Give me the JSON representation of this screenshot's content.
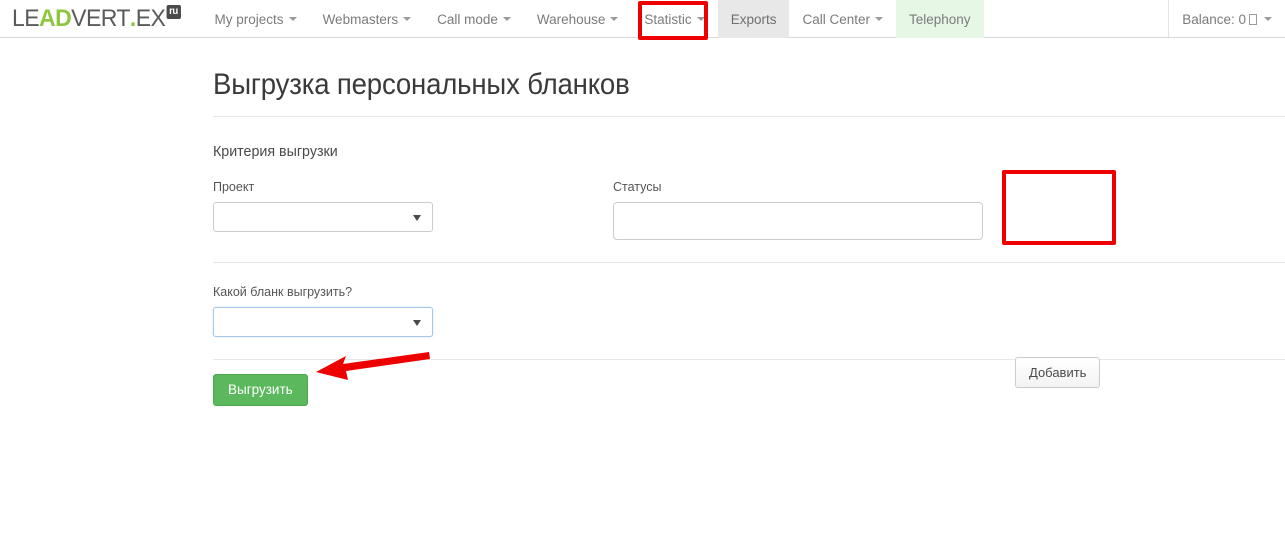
{
  "brand": {
    "part1": "LE",
    "part_ad": "AD",
    "part2": "VERT",
    "dot": ".",
    "part3": "EX",
    "badge": "ru"
  },
  "nav": {
    "items": [
      {
        "label": "My projects",
        "caret": true,
        "state": "normal"
      },
      {
        "label": "Webmasters",
        "caret": true,
        "state": "normal"
      },
      {
        "label": "Call mode",
        "caret": true,
        "state": "normal"
      },
      {
        "label": "Warehouse",
        "caret": true,
        "state": "normal"
      },
      {
        "label": "Statistic",
        "caret": true,
        "state": "normal"
      },
      {
        "label": "Exports",
        "caret": false,
        "state": "active"
      },
      {
        "label": "Call Center",
        "caret": true,
        "state": "normal"
      },
      {
        "label": "Telephony",
        "caret": false,
        "state": "greenbg"
      }
    ],
    "balance_label": "Balance: 0"
  },
  "page": {
    "title": "Выгрузка персональных бланков",
    "section_title": "Критерия выгрузки"
  },
  "form": {
    "project_label": "Проект",
    "project_value": "",
    "project_placeholder": "",
    "statuses_label": "Статусы",
    "statuses_value": "",
    "statuses_placeholder": "",
    "add_button": "Добавить",
    "blank_label": "Какой бланк выгрузить?",
    "blank_value": "",
    "submit_button": "Выгрузить"
  },
  "annotations": {
    "exports_highlight": "red-box-around-exports-tab",
    "add_highlight": "red-box-around-add-button",
    "arrow": "red-arrow-pointing-at-submit-button",
    "color": "#ee0000"
  },
  "colors": {
    "brand_green": "#8dc63f",
    "submit_green": "#5cb85c",
    "annotation_red": "#ee0000",
    "telephony_bg": "#e6f7e6",
    "active_tab_bg": "#e8e8e8"
  }
}
